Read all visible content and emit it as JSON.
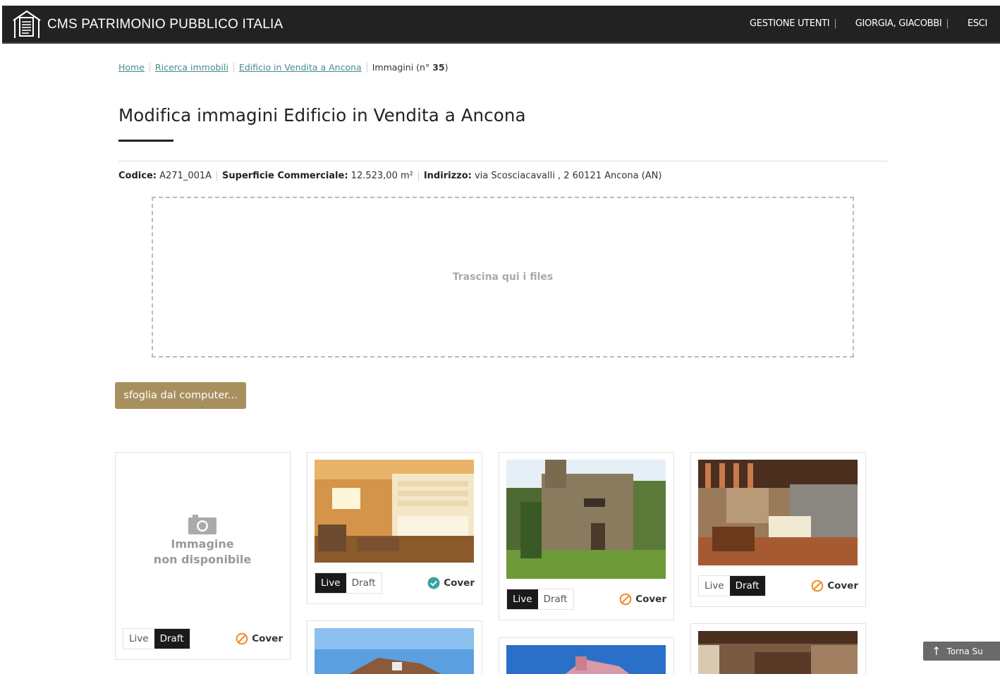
{
  "header": {
    "brand": "CMS PATRIMONIO PUBBLICO ITALIA",
    "logo_icon": "building-document-icon",
    "nav": [
      {
        "label": "GESTIONE UTENTI"
      },
      {
        "label": "GIORGIA, GIACOBBI"
      },
      {
        "label": "ESCI"
      }
    ],
    "separator": "|"
  },
  "breadcrumb": {
    "items": [
      "Home",
      "Ricerca immobili",
      "Edificio in Vendita a Ancona"
    ],
    "current_prefix": "Immagini (n°",
    "current_count": "35",
    "current_suffix": ")"
  },
  "page": {
    "title": "Modifica immagini Edificio in Vendita a Ancona"
  },
  "meta": {
    "code_label": "Codice:",
    "code_value": "A271_001A",
    "area_label": "Superficie Commerciale:",
    "area_value": "12.523,00 m²",
    "address_label": "Indirizzo:",
    "address_value": "via Scosciacavalli , 2 60121 Ancona (AN)"
  },
  "dropzone": {
    "text": "Trascina qui i files"
  },
  "browse_button": "sfoglia dal computer...",
  "gallery": {
    "live_label": "Live",
    "draft_label": "Draft",
    "cover_label": "Cover",
    "no_image_line1": "Immagine",
    "no_image_line2": "non disponibile",
    "cards": [
      {
        "status": "Draft",
        "is_cover": false,
        "image": "none"
      },
      {
        "status": "Live",
        "is_cover": true,
        "image": "kitchen-living-room"
      },
      {
        "status": "Live",
        "is_cover": false,
        "image": "stone-villa-exterior"
      },
      {
        "status": "Draft",
        "is_cover": false,
        "image": "rustic-living-room"
      },
      {
        "image": "house-exterior-blue-sky"
      },
      {
        "image": "pink-villa-blue-sky"
      },
      {
        "image": "wooden-beam-interior"
      }
    ]
  },
  "back_to_top": "Torna Su",
  "colors": {
    "header_bg": "#222222",
    "accent_gold": "#a8905e",
    "link_teal": "#4a8a8c",
    "cover_active": "#3ba3a3",
    "cover_inactive": "#f08a24"
  }
}
